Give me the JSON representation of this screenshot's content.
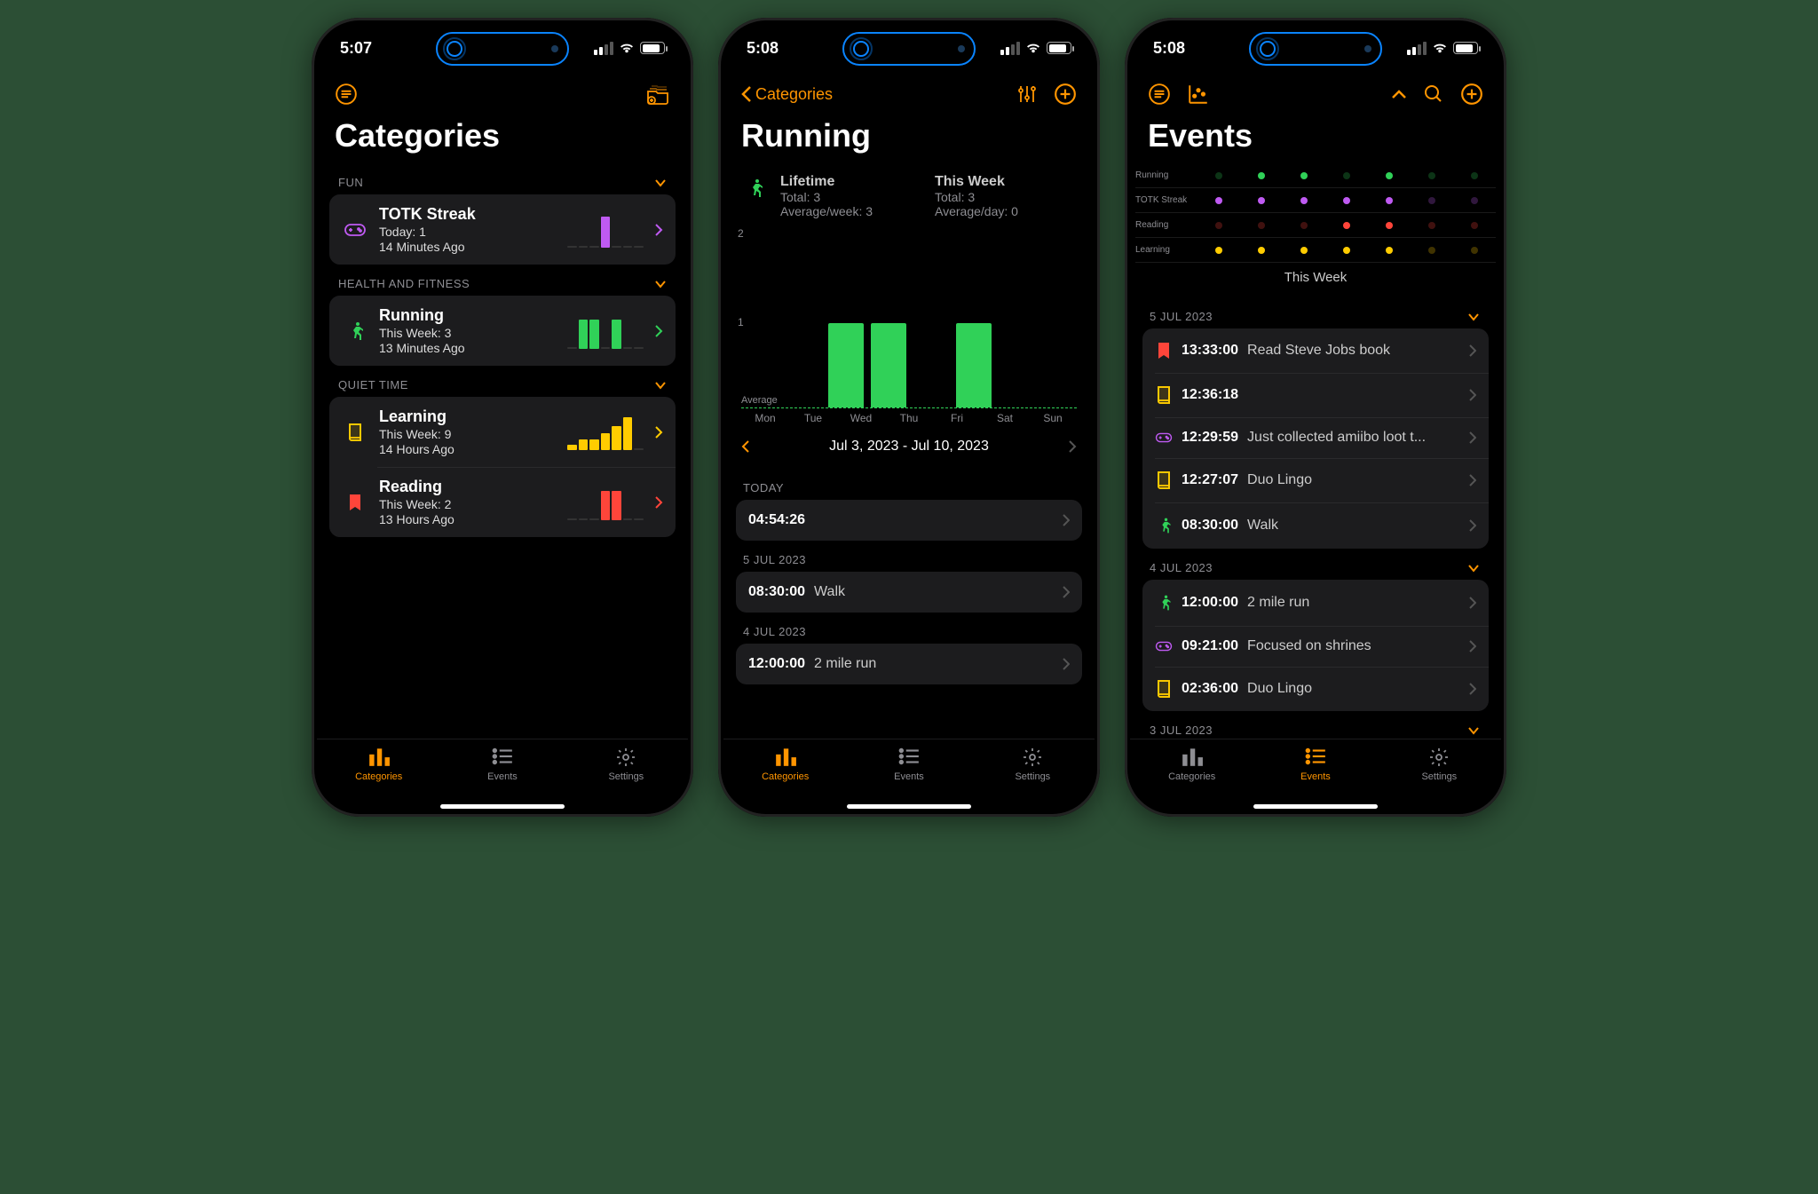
{
  "status_time_a": "5:07",
  "status_time_b": "5:08",
  "status_time_c": "5:08",
  "tabs": {
    "categories": "Categories",
    "events": "Events",
    "settings": "Settings"
  },
  "phone1": {
    "title": "Categories",
    "groups": [
      {
        "name": "FUN",
        "items": [
          {
            "title": "TOTK Streak",
            "sub1": "Today: 1",
            "sub2": "14 Minutes Ago",
            "icon": "controller",
            "color": "#bf5af2",
            "chev": "#bf5af2",
            "spark": [
              0,
              0,
              0,
              0.9,
              0,
              0,
              0
            ]
          }
        ]
      },
      {
        "name": "HEALTH AND FITNESS",
        "items": [
          {
            "title": "Running",
            "sub1": "This Week: 3",
            "sub2": "13 Minutes Ago",
            "icon": "runner",
            "color": "#30d158",
            "chev": "#30d158",
            "spark": [
              0,
              0.85,
              0.85,
              0,
              0.85,
              0,
              0
            ]
          }
        ]
      },
      {
        "name": "QUIET TIME",
        "items": [
          {
            "title": "Learning",
            "sub1": "This Week: 9",
            "sub2": "14 Hours Ago",
            "icon": "book",
            "color": "#ffcc00",
            "chev": "#ffcc00",
            "spark": [
              0.15,
              0.3,
              0.3,
              0.5,
              0.7,
              0.95,
              0
            ]
          },
          {
            "title": "Reading",
            "sub1": "This Week: 2",
            "sub2": "13 Hours Ago",
            "icon": "bookmark",
            "color": "#ff453a",
            "chev": "#ff453a",
            "spark": [
              0,
              0,
              0,
              0.85,
              0.85,
              0,
              0
            ]
          }
        ]
      }
    ]
  },
  "phone2": {
    "back": "Categories",
    "title": "Running",
    "lifetime_label": "Lifetime",
    "lifetime_total": "Total: 3",
    "lifetime_avg": "Average/week: 3",
    "week_label": "This Week",
    "week_total": "Total: 3",
    "week_avg": "Average/day: 0",
    "date_range": "Jul 3, 2023 - Jul 10, 2023",
    "sections": [
      {
        "name": "TODAY",
        "rows": [
          {
            "time": "04:54:26",
            "desc": ""
          }
        ]
      },
      {
        "name": "5 JUL 2023",
        "rows": [
          {
            "time": "08:30:00",
            "desc": "Walk"
          }
        ]
      },
      {
        "name": "4 JUL 2023",
        "rows": [
          {
            "time": "12:00:00",
            "desc": "2 mile run"
          }
        ]
      }
    ]
  },
  "chart_data": {
    "type": "bar",
    "title": "Running — weekly count",
    "categories": [
      "Mon",
      "Tue",
      "Wed",
      "Thu",
      "Fri",
      "Sat",
      "Sun"
    ],
    "values": [
      0,
      1,
      1,
      0,
      1,
      0,
      0
    ],
    "ylim": [
      0,
      2
    ],
    "average_label": "Average"
  },
  "phone3": {
    "title": "Events",
    "dotchart_caption": "This Week",
    "dotchart_rows": [
      "Running",
      "TOTK Streak",
      "Reading",
      "Learning"
    ],
    "dotchart_colors": [
      "#30d158",
      "#bf5af2",
      "#ff453a",
      "#ffcc00"
    ],
    "dotchart_data": [
      [
        0,
        1,
        1,
        0,
        1,
        0,
        0
      ],
      [
        1,
        1,
        1,
        1,
        1,
        0,
        0
      ],
      [
        0,
        0,
        0,
        1,
        1,
        0,
        0
      ],
      [
        1,
        1,
        1,
        1,
        1,
        0,
        0
      ]
    ],
    "sections": [
      {
        "name": "5 JUL 2023",
        "rows": [
          {
            "icon": "bookmark",
            "color": "#ff453a",
            "time": "13:33:00",
            "desc": "Read Steve Jobs book"
          },
          {
            "icon": "book",
            "color": "#ffcc00",
            "time": "12:36:18",
            "desc": ""
          },
          {
            "icon": "controller",
            "color": "#bf5af2",
            "time": "12:29:59",
            "desc": "Just collected amiibo loot t..."
          },
          {
            "icon": "book",
            "color": "#ffcc00",
            "time": "12:27:07",
            "desc": "Duo Lingo"
          },
          {
            "icon": "runner",
            "color": "#30d158",
            "time": "08:30:00",
            "desc": "Walk"
          }
        ]
      },
      {
        "name": "4 JUL 2023",
        "rows": [
          {
            "icon": "runner",
            "color": "#30d158",
            "time": "12:00:00",
            "desc": "2 mile run"
          },
          {
            "icon": "controller",
            "color": "#bf5af2",
            "time": "09:21:00",
            "desc": "Focused on shrines"
          },
          {
            "icon": "book",
            "color": "#ffcc00",
            "time": "02:36:00",
            "desc": "Duo Lingo"
          }
        ]
      },
      {
        "name": "3 JUL 2023",
        "rows": []
      }
    ]
  }
}
